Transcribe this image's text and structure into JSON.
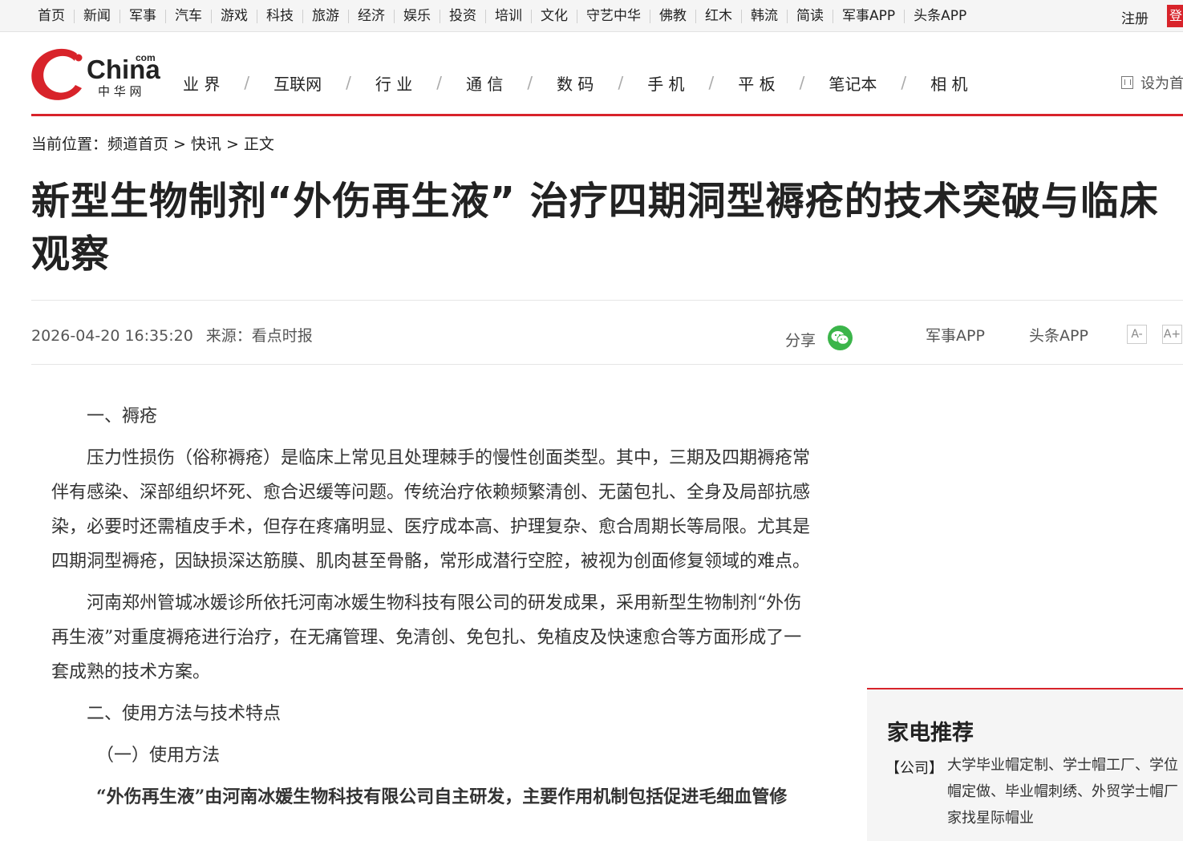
{
  "topbar": {
    "links": [
      "首页",
      "新闻",
      "军事",
      "汽车",
      "游戏",
      "科技",
      "旅游",
      "经济",
      "娱乐",
      "投资",
      "培训",
      "文化",
      "守艺中华",
      "佛教",
      "红木",
      "韩流",
      "简读",
      "军事APP",
      "头条APP"
    ],
    "register": "注册",
    "login": "登"
  },
  "logo": {
    "word": "China",
    "com": "com",
    "cn": "中 华 网"
  },
  "mainnav": [
    "业 界",
    "互联网",
    "行 业",
    "通 信",
    "数 码",
    "手 机",
    "平 板",
    "笔记本",
    "相 机"
  ],
  "sethome": "设为首页",
  "breadcrumb": {
    "prefix": "当前位置：",
    "items": [
      "频道首页",
      "快讯",
      "正文"
    ],
    "sep": ">"
  },
  "article": {
    "title": "新型生物制剂“外伤再生液” 治疗四期洞型褥疮的技术突破与临床观察",
    "datetime": "2026-04-20 16:35:20",
    "source": "来源：看点时报",
    "share": "分享",
    "app1": "军事APP",
    "app2": "头条APP",
    "font_minus": "A-",
    "font_plus": "A+",
    "paragraphs": [
      "一、褥疮",
      "压力性损伤（俗称褥疮）是临床上常见且处理棘手的慢性创面类型。其中，三期及四期褥疮常伴有感染、深部组织坏死、愈合迟缓等问题。传统治疗依赖频繁清创、无菌包扎、全身及局部抗感染，必要时还需植皮手术，但存在疼痛明显、医疗成本高、护理复杂、愈合周期长等局限。尤其是四期洞型褥疮，因缺损深达筋膜、肌肉甚至骨骼，常形成潜行空腔，被视为创面修复领域的难点。",
      "河南郑州管城冰媛诊所依托河南冰媛生物科技有限公司的研发成果，采用新型生物制剂“外伤再生液”对重度褥疮进行治疗，在无痛管理、免清创、免包扎、免植皮及快速愈合等方面形成了一套成熟的技术方案。",
      "二、使用方法与技术特点",
      "（一）使用方法",
      "“外伤再生液”由河南冰媛生物科技有限公司自主研发，主要作用机制包括促进毛细血管修"
    ]
  },
  "sidebar": {
    "title": "家电推荐",
    "tag": "【公司】",
    "desc": "大学毕业帽定制、学士帽工厂、学位帽定做、毕业帽刺绣、外贸学士帽厂家找星际帽业"
  },
  "colors": {
    "brand_red": "#d8232a",
    "wechat_green": "#3bb54a"
  }
}
